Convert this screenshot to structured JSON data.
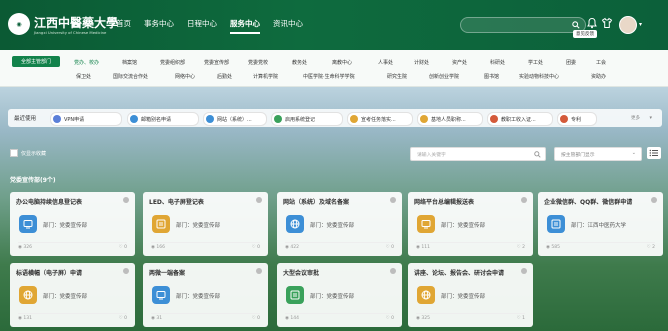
{
  "header": {
    "logo_cn": "江西中醫藥大學",
    "logo_en": "Jiangxi University of Chinese Medicine",
    "nav": [
      "首页",
      "事务中心",
      "日程中心",
      "服务中心",
      "资讯中心"
    ],
    "search_placeholder": "",
    "tooltip": "意见反馈",
    "brand_color": "#0e6b3e"
  },
  "departments": {
    "all_label": "全部主管部门",
    "row1": [
      "党办、校办",
      "档案馆",
      "党委组织部",
      "党委宣传部",
      "党委党校",
      "教务处",
      "离教中心",
      "人事处",
      "计财处",
      "资产处",
      "科研处",
      "学工处",
      "团委",
      "工会"
    ],
    "row2": [
      "保卫处",
      "国际交流合作处",
      "网络中心",
      "后勤处",
      "计算机学院",
      "中医学院·生命科学学院",
      "研究生院",
      "创新创业学院",
      "图书馆",
      "实验动物科技中心",
      "资助办"
    ]
  },
  "recent": {
    "label": "最近使用",
    "items": [
      {
        "label": "VPN申请",
        "color": "#5b7fd8"
      },
      {
        "label": "邮箱别名申请",
        "color": "#3d8fd6"
      },
      {
        "label": "网站（系统）...",
        "color": "#3d8fd6"
      },
      {
        "label": "启用系统登记",
        "color": "#3aa15b"
      },
      {
        "label": "宣考任务落实...",
        "color": "#e0a634"
      },
      {
        "label": "基地人员职称...",
        "color": "#e0a634"
      },
      {
        "label": "教职工收入证...",
        "color": "#d45a3a"
      },
      {
        "label": "专利",
        "color": "#d45a3a"
      }
    ],
    "more": "更多"
  },
  "filters": {
    "checkbox_label": "仅显示收藏",
    "keyword_placeholder": "请输入关键字",
    "dept_placeholder": "按主管部门显示"
  },
  "group_title": "党委宣传部(9个)",
  "cards": [
    {
      "title": "办公电脑持续信息登记表",
      "dept": "部门：党委宣传部",
      "views": "326",
      "likes": "0",
      "color": "#3d8fd6"
    },
    {
      "title": "LED、电子屏登记表",
      "dept": "部门：党委宣传部",
      "views": "166",
      "likes": "0",
      "color": "#e0a634"
    },
    {
      "title": "网站（系统）及域名备案",
      "dept": "部门：党委宣传部",
      "views": "422",
      "likes": "0",
      "color": "#3d8fd6"
    },
    {
      "title": "网络平台总编辑报送表",
      "dept": "部门：党委宣传部",
      "views": "111",
      "likes": "2",
      "color": "#e0a634"
    },
    {
      "title": "企业微信群、QQ群、微信群申请",
      "dept": "部门：江西中医药大学",
      "views": "585",
      "likes": "2",
      "color": "#3d8fd6"
    },
    {
      "title": "标语横幅（电子屏）申请",
      "dept": "部门：党委宣传部",
      "views": "131",
      "likes": "0",
      "color": "#e0a634"
    },
    {
      "title": "两微一端备案",
      "dept": "部门：党委宣传部",
      "views": "31",
      "likes": "0",
      "color": "#3d8fd6"
    },
    {
      "title": "大型会议审批",
      "dept": "部门：党委宣传部",
      "views": "144",
      "likes": "0",
      "color": "#3aa15b"
    },
    {
      "title": "讲座、论坛、报告会、研讨会申请",
      "dept": "部门：党委宣传部",
      "views": "325",
      "likes": "1",
      "color": "#e0a634"
    }
  ]
}
